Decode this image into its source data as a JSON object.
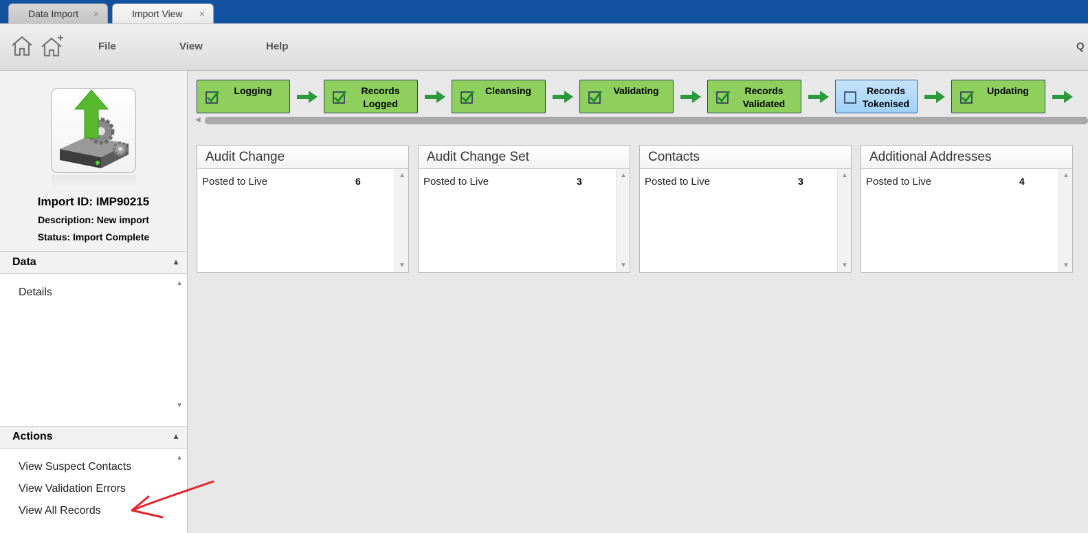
{
  "tabs": [
    {
      "label": "Data Import",
      "close": "×"
    },
    {
      "label": "Import View",
      "close": "×"
    }
  ],
  "toolbar": {
    "menus": [
      "File",
      "View",
      "Help"
    ],
    "right_label": "Q"
  },
  "import_info": {
    "id": "Import ID: IMP90215",
    "description": "Description: New import",
    "status": "Status: Import Complete"
  },
  "data_section": {
    "title": "Data",
    "items": [
      "Details"
    ]
  },
  "actions_section": {
    "title": "Actions",
    "items": [
      "View Suspect Contacts",
      "View Validation Errors",
      "View All Records"
    ]
  },
  "workflow": [
    {
      "label": "Logging",
      "done": true
    },
    {
      "label": "Records Logged",
      "done": true
    },
    {
      "label": "Cleansing",
      "done": true
    },
    {
      "label": "Validating",
      "done": true
    },
    {
      "label": "Records Validated",
      "done": true
    },
    {
      "label": "Records Tokenised",
      "done": false
    },
    {
      "label": "Updating",
      "done": true
    }
  ],
  "cards": [
    {
      "title": "Audit Change",
      "row_label": "Posted to Live",
      "row_value": "6"
    },
    {
      "title": "Audit Change Set",
      "row_label": "Posted to Live",
      "row_value": "3"
    },
    {
      "title": "Contacts",
      "row_label": "Posted to Live",
      "row_value": "3"
    },
    {
      "title": "Additional Addresses",
      "row_label": "Posted to Live",
      "row_value": "4"
    }
  ],
  "colors": {
    "tabbar": "#1352a0",
    "stage_done": "#8ecf5e",
    "stage_pending": "#a8d5f8",
    "arrow": "#2a9a3a",
    "annotation": "#e8232a"
  }
}
